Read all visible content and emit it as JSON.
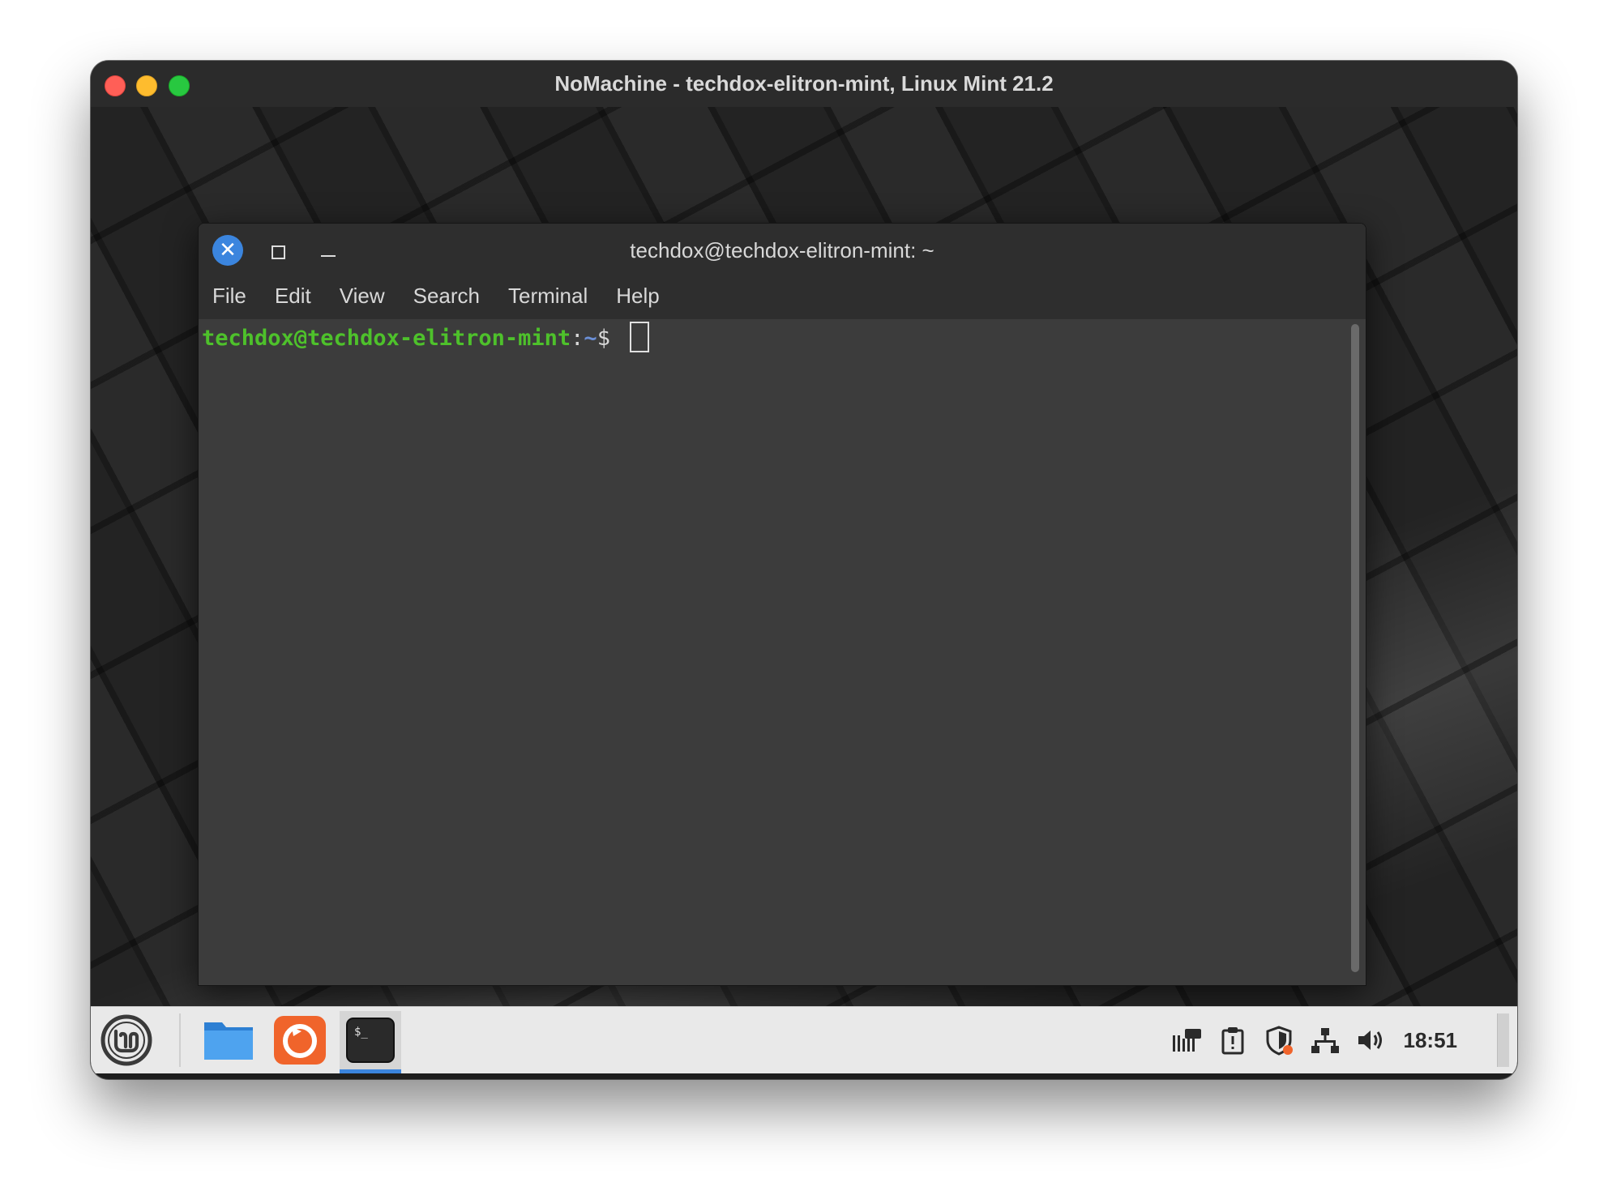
{
  "host_window": {
    "title": "NoMachine - techdox-elitron-mint, Linux Mint 21.2"
  },
  "terminal": {
    "title": "techdox@techdox-elitron-mint: ~",
    "close_symbol": "✕",
    "menu": [
      "File",
      "Edit",
      "View",
      "Search",
      "Terminal",
      "Help"
    ],
    "prompt": {
      "user_host": "techdox@techdox-elitron-mint",
      "separator": ":",
      "path": "~",
      "symbol": "$ "
    }
  },
  "taskbar": {
    "launchers": [
      {
        "name": "files-launcher",
        "icon": "folder-icon"
      },
      {
        "name": "firefox-launcher",
        "icon": "firefox-icon"
      },
      {
        "name": "terminal-launcher",
        "icon": "terminal-icon",
        "glyph": "$_",
        "active": true
      }
    ],
    "tray": [
      "notification-icon",
      "clipboard-icon",
      "shield-icon",
      "network-icon",
      "volume-icon"
    ],
    "clock": "18:51"
  },
  "colors": {
    "prompt_user": "#4ec12b",
    "prompt_path": "#6b8fd6",
    "accent": "#3b85de",
    "firefox": "#f0642b"
  }
}
